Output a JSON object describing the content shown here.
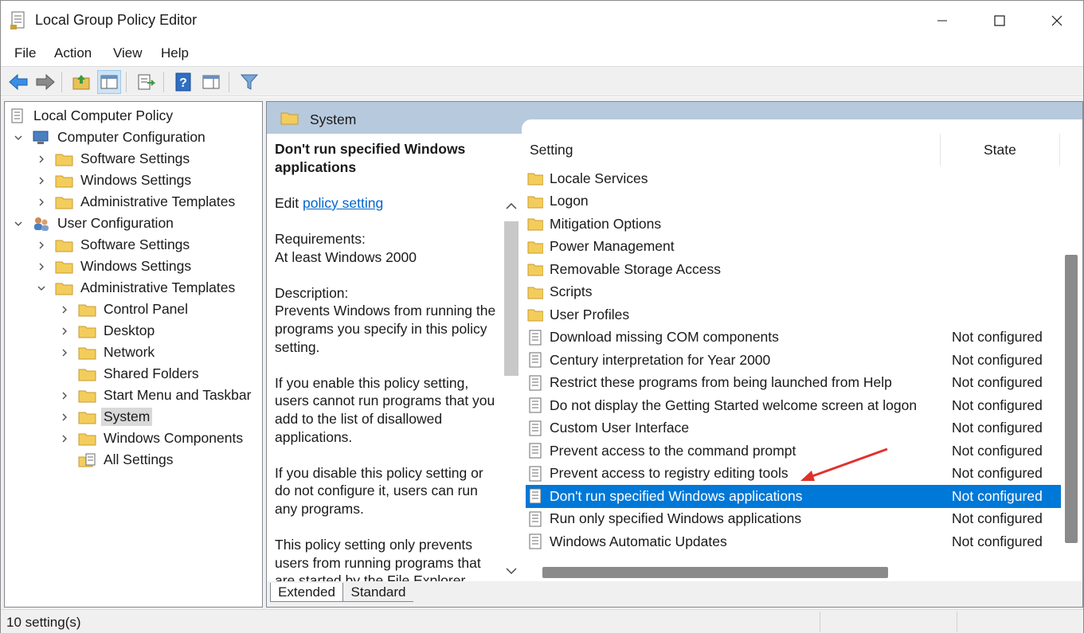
{
  "window": {
    "title": "Local Group Policy Editor",
    "controls": [
      "minimize",
      "maximize",
      "close"
    ]
  },
  "menu": [
    "File",
    "Action",
    "View",
    "Help"
  ],
  "toolbar": {
    "buttons": [
      "back-icon",
      "forward-icon",
      "up-folder-icon",
      "show-hide-console-tree-icon",
      "export-list-icon",
      "help-icon",
      "show-action-pane-icon",
      "filter-icon"
    ]
  },
  "tree": {
    "root": "Local Computer Policy",
    "items": [
      {
        "label": "Computer Configuration"
      },
      {
        "label": "Software Settings"
      },
      {
        "label": "Windows Settings"
      },
      {
        "label": "Administrative Templates"
      },
      {
        "label": "User Configuration"
      },
      {
        "label": "Software Settings"
      },
      {
        "label": "Windows Settings"
      },
      {
        "label": "Administrative Templates"
      },
      {
        "label": "Control Panel"
      },
      {
        "label": "Desktop"
      },
      {
        "label": "Network"
      },
      {
        "label": "Shared Folders"
      },
      {
        "label": "Start Menu and Taskbar"
      },
      {
        "label": "System"
      },
      {
        "label": "Windows Components"
      },
      {
        "label": "All Settings"
      }
    ]
  },
  "header": {
    "title": "System"
  },
  "description": {
    "policy_title": "Don't run specified Windows applications",
    "edit_prefix": "Edit ",
    "edit_link": "policy setting ",
    "requirements_label": "Requirements:",
    "requirements_value": "At least Windows 2000",
    "description_label": "Description:",
    "para1": "Prevents Windows from running the programs you specify in this policy setting.",
    "para2": "If you enable this policy setting, users cannot run programs that you add to the list of disallowed applications.",
    "para3": "If you disable this policy setting or do not configure it, users can run any programs.",
    "para4": "This policy setting only prevents users from running programs that are started by the File Explorer"
  },
  "list": {
    "col_setting": "Setting",
    "col_state": "State",
    "folders": [
      "Locale Services",
      "Logon",
      "Mitigation Options",
      "Power Management",
      "Removable Storage Access",
      "Scripts",
      "User Profiles"
    ],
    "settings": [
      {
        "name": "Download missing COM components",
        "state": "Not configured"
      },
      {
        "name": "Century interpretation for Year 2000",
        "state": "Not configured"
      },
      {
        "name": "Restrict these programs from being launched from Help",
        "state": "Not configured"
      },
      {
        "name": "Do not display the Getting Started welcome screen at logon",
        "state": "Not configured"
      },
      {
        "name": "Custom User Interface",
        "state": "Not configured"
      },
      {
        "name": "Prevent access to the command prompt",
        "state": "Not configured"
      },
      {
        "name": "Prevent access to registry editing tools",
        "state": "Not configured"
      },
      {
        "name": "Don't run specified Windows applications",
        "state": "Not configured"
      },
      {
        "name": "Run only specified Windows applications",
        "state": "Not configured"
      },
      {
        "name": "Windows Automatic Updates",
        "state": "Not configured"
      }
    ]
  },
  "tabs": [
    "Extended",
    "Standard"
  ],
  "status": {
    "text": "10 setting(s)"
  },
  "colors": {
    "selection": "#0078d7",
    "header_band": "#b7c9dd",
    "annotation_arrow": "#e0322b"
  }
}
